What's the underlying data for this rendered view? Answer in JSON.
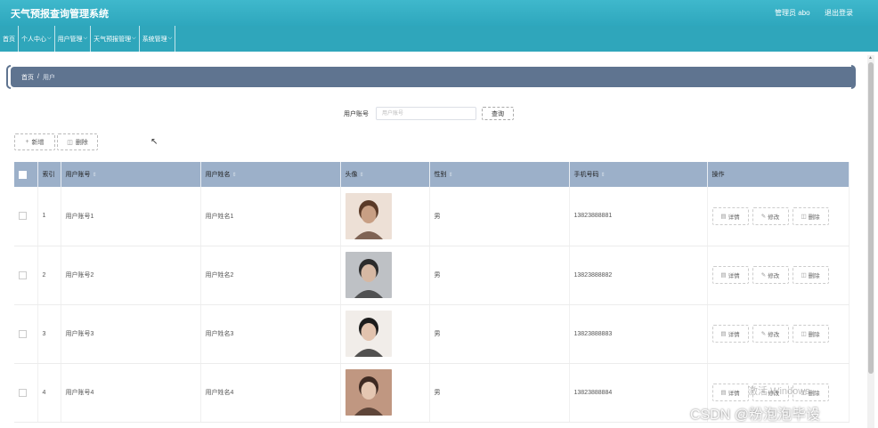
{
  "app": {
    "title": "天气预报查询管理系统",
    "admin_label": "管理员 abo",
    "logout_label": "退出登录"
  },
  "nav": {
    "items": [
      {
        "label": "首页",
        "has_menu": false
      },
      {
        "label": "个人中心",
        "has_menu": true
      },
      {
        "label": "用户管理",
        "has_menu": true
      },
      {
        "label": "天气预报管理",
        "has_menu": true
      },
      {
        "label": "系统管理",
        "has_menu": true
      }
    ],
    "chevron": "⌵"
  },
  "breadcrumb": {
    "home": "首页",
    "separator": "/",
    "current": "用户"
  },
  "search": {
    "label": "用户账号",
    "placeholder": "用户账号",
    "button_label": "查询"
  },
  "toolbar": {
    "add_icon": "+",
    "add_label": "新增",
    "delete_icon": "🗑",
    "delete_label": "删除"
  },
  "table": {
    "headers": [
      "",
      "索引",
      "用户账号",
      "用户姓名",
      "头像",
      "性别",
      "手机号码",
      "操作"
    ],
    "sortable": [
      false,
      false,
      true,
      true,
      true,
      true,
      true,
      false
    ],
    "rows": [
      {
        "index": "1",
        "account": "用户账号1",
        "name": "用户姓名1",
        "avatar": "avatar-1",
        "gender": "男",
        "phone": "13823888881"
      },
      {
        "index": "2",
        "account": "用户账号2",
        "name": "用户姓名2",
        "avatar": "avatar-2",
        "gender": "男",
        "phone": "13823888882"
      },
      {
        "index": "3",
        "account": "用户账号3",
        "name": "用户姓名3",
        "avatar": "avatar-3",
        "gender": "男",
        "phone": "13823888883"
      },
      {
        "index": "4",
        "account": "用户账号4",
        "name": "用户姓名4",
        "avatar": "avatar-4",
        "gender": "男",
        "phone": "13823888884"
      }
    ],
    "actions": {
      "detail": "详情",
      "edit": "修改",
      "delete": "删除"
    }
  },
  "watermark": {
    "windows": "激活 Windows",
    "csdn": "CSDN @粉泡泡毕设"
  },
  "colors": {
    "header_bg": "#2fa6bb",
    "breadcrumb_bg": "#5f7490",
    "table_header_bg": "#9cb0c9"
  }
}
